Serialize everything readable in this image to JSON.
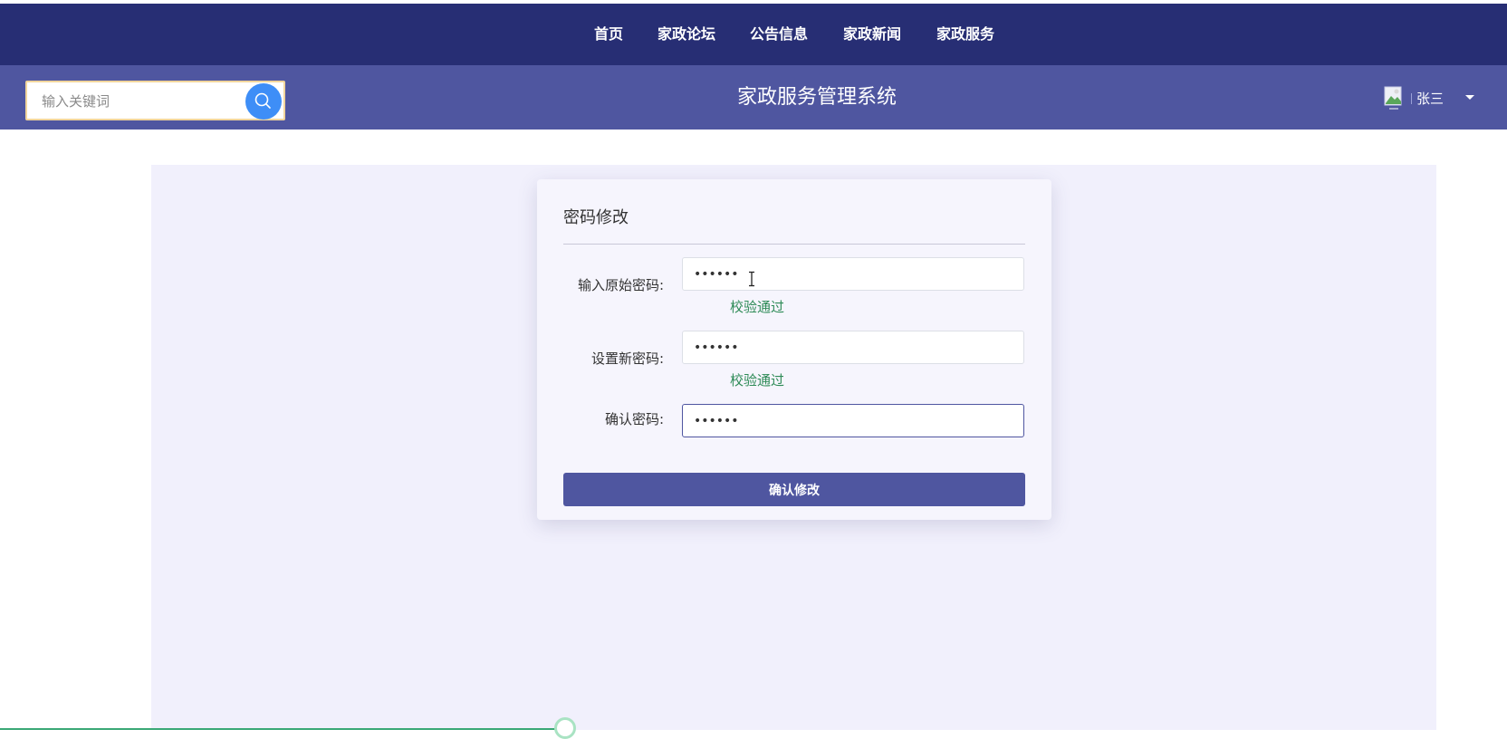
{
  "nav": {
    "items": [
      {
        "label": "首页"
      },
      {
        "label": "家政论坛"
      },
      {
        "label": "公告信息"
      },
      {
        "label": "家政新闻"
      },
      {
        "label": "家政服务"
      }
    ]
  },
  "header": {
    "search_placeholder": "输入关键词",
    "site_title": "家政服务管理系统",
    "username": "张三"
  },
  "form": {
    "title": "密码修改",
    "fields": [
      {
        "label": "输入原始密码:",
        "value": "••••••",
        "validation": "校验通过"
      },
      {
        "label": "设置新密码:",
        "value": "••••••",
        "validation": "校验通过"
      },
      {
        "label": "确认密码:",
        "value": "••••••",
        "validation": ""
      }
    ],
    "submit_label": "确认修改"
  },
  "progress": {
    "fraction": 0.375
  },
  "colors": {
    "nav_bg": "#272e74",
    "header_bg": "#4f56a0",
    "search_button": "#3e8ef7",
    "validation_text": "#2e8b57",
    "content_bg": "#f1f0fc"
  },
  "icons": {
    "search": "search-icon",
    "avatar": "avatar-icon",
    "caret": "caret-down-icon",
    "cursor": "text-cursor-icon"
  }
}
